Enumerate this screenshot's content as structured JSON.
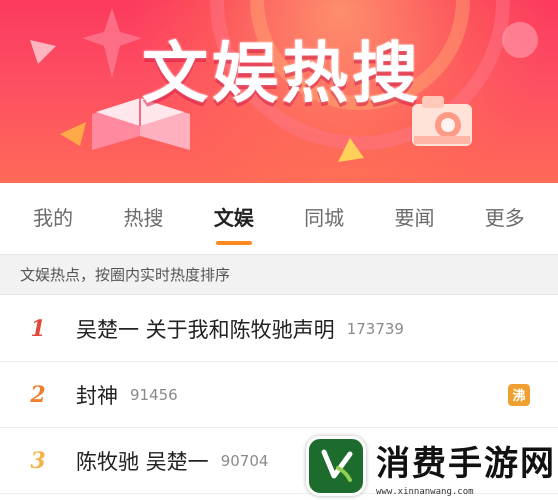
{
  "banner": {
    "title": "文娱热搜",
    "colors": {
      "top": "#fb3a5e",
      "bottom": "#ff6a57"
    }
  },
  "tabs": [
    {
      "label": "我的",
      "active": false
    },
    {
      "label": "热搜",
      "active": false
    },
    {
      "label": "文娱",
      "active": true
    },
    {
      "label": "同城",
      "active": false
    },
    {
      "label": "要闻",
      "active": false
    },
    {
      "label": "更多",
      "active": false
    }
  ],
  "subheader": {
    "text": "文娱热点，按圈内实时热度排序"
  },
  "list": [
    {
      "rank": "1",
      "topic": "吴楚一 关于我和陈牧驰声明",
      "heat": "173739",
      "badge": ""
    },
    {
      "rank": "2",
      "topic": "封神",
      "heat": "91456",
      "badge": "沸"
    },
    {
      "rank": "3",
      "topic": "陈牧驰 吴楚一",
      "heat": "90704",
      "badge": ""
    }
  ],
  "watermark": {
    "title": "消费手游网",
    "url": "www.xinnanwang.com"
  },
  "accent_color": "#ff8a1f"
}
